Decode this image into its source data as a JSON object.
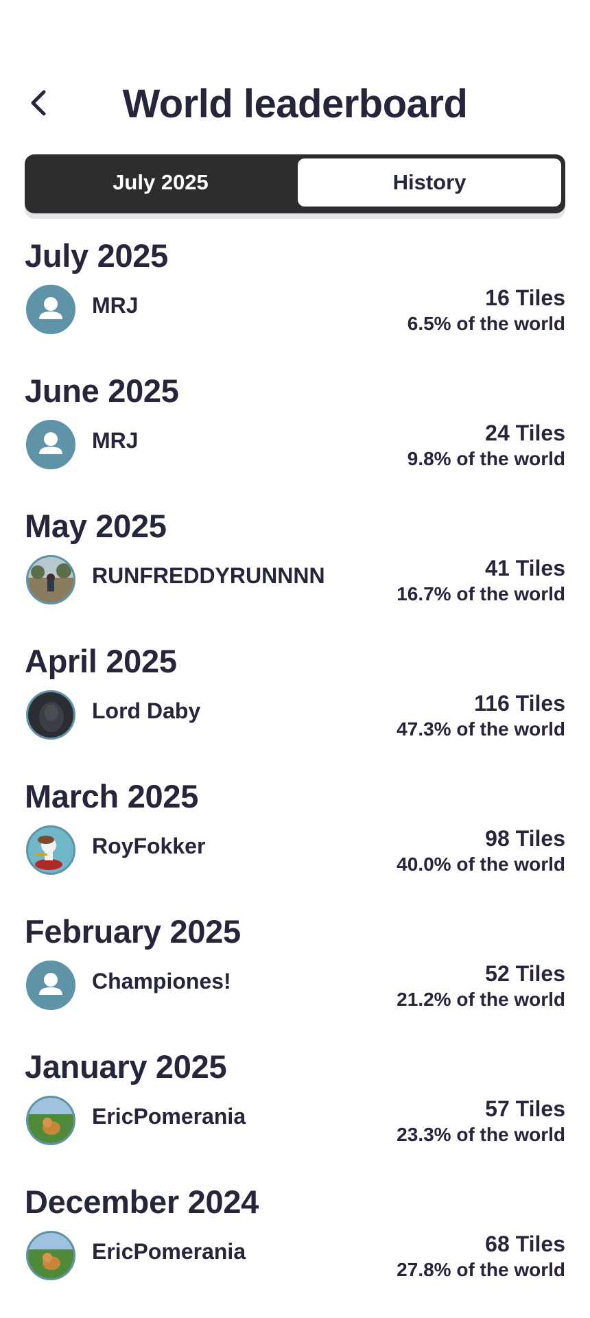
{
  "header": {
    "title": "World leaderboard",
    "back_icon": "chevron-left-icon"
  },
  "tabs": [
    {
      "label": "July 2025",
      "selected": true
    },
    {
      "label": "History",
      "selected": false
    }
  ],
  "entries": [
    {
      "month": "July 2025",
      "user": "MRJ",
      "avatar": "default-user-icon",
      "tiles": "16 Tiles",
      "percent": "6.5% of the world"
    },
    {
      "month": "June 2025",
      "user": "MRJ",
      "avatar": "default-user-icon",
      "tiles": "24 Tiles",
      "percent": "9.8% of the world"
    },
    {
      "month": "May 2025",
      "user": "RUNFREDDYRUNNNN",
      "avatar": "photo-avatar",
      "tiles": "41 Tiles",
      "percent": "16.7% of the world"
    },
    {
      "month": "April 2025",
      "user": "Lord Daby",
      "avatar": "photo-avatar",
      "tiles": "116 Tiles",
      "percent": "47.3% of the world"
    },
    {
      "month": "March 2025",
      "user": "RoyFokker",
      "avatar": "photo-avatar",
      "tiles": "98 Tiles",
      "percent": "40.0% of the world"
    },
    {
      "month": "February 2025",
      "user": "Championes!",
      "avatar": "default-user-icon",
      "tiles": "52 Tiles",
      "percent": "21.2% of the world"
    },
    {
      "month": "January 2025",
      "user": "EricPomerania",
      "avatar": "photo-avatar",
      "tiles": "57 Tiles",
      "percent": "23.3% of the world"
    },
    {
      "month": "December 2024",
      "user": "EricPomerania",
      "avatar": "photo-avatar",
      "tiles": "68 Tiles",
      "percent": "27.8% of the world"
    }
  ],
  "colors": {
    "text": "#26263a",
    "tab_bar": "#2d2d30",
    "avatar_default": "#5f93a8"
  }
}
